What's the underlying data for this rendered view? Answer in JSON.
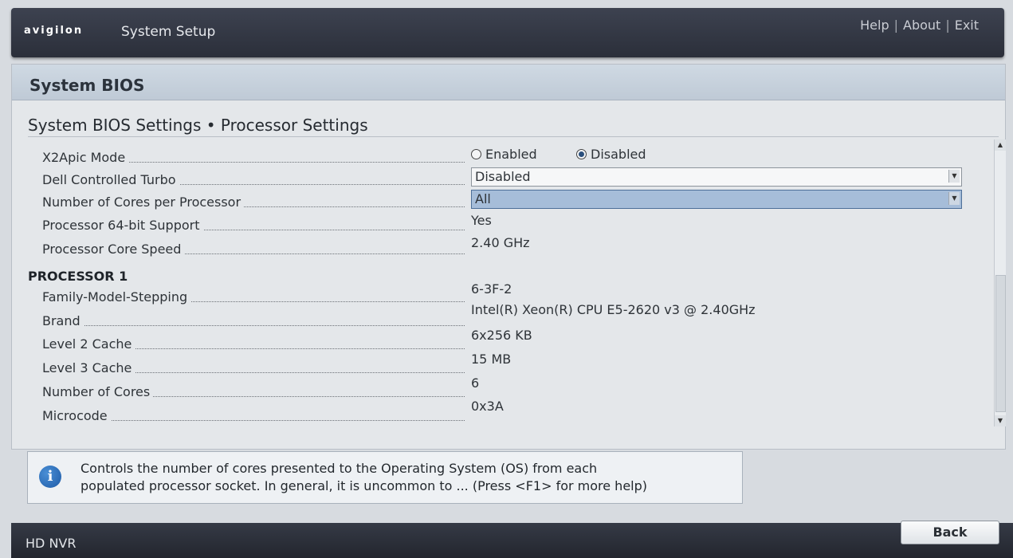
{
  "header": {
    "logo": "avigilon",
    "title": "System Setup",
    "links": [
      "Help",
      "About",
      "Exit"
    ]
  },
  "panel": {
    "title": "System BIOS",
    "section_title": "System BIOS Settings • Processor Settings"
  },
  "settings": [
    {
      "label": "X2Apic Mode",
      "type": "radio",
      "options": [
        "Enabled",
        "Disabled"
      ],
      "selected": "Disabled"
    },
    {
      "label": "Dell Controlled Turbo",
      "type": "dropdown",
      "value": "Disabled"
    },
    {
      "label": "Number of Cores per Processor",
      "type": "dropdown",
      "value": "All",
      "focused": true
    },
    {
      "label": "Processor 64-bit Support",
      "type": "text",
      "value": "Yes"
    },
    {
      "label": "Processor Core Speed",
      "type": "text",
      "value": "2.40 GHz"
    }
  ],
  "processor1": {
    "header": "PROCESSOR 1",
    "rows": [
      {
        "label": "Family-Model-Stepping",
        "value": "6-3F-2"
      },
      {
        "label": "Brand",
        "value": "Intel(R) Xeon(R) CPU E5-2620 v3 @ 2.40GHz"
      },
      {
        "label": "Level 2 Cache",
        "value": "6x256 KB"
      },
      {
        "label": "Level 3 Cache",
        "value": "15 MB"
      },
      {
        "label": "Number of Cores",
        "value": "6"
      },
      {
        "label": "Microcode",
        "value": "0x3A"
      }
    ]
  },
  "help": {
    "line1": "Controls the number of cores presented to the Operating System (OS) from each",
    "line2": "populated processor socket. In general, it is uncommon to ... (Press <F1> for more help)"
  },
  "footer": {
    "device": "HD NVR",
    "back_label": "Back"
  },
  "icons": {
    "info": "info-icon",
    "scroll_up": "scroll-up-arrow-icon",
    "scroll_down": "scroll-down-arrow-icon",
    "dropdown": "dropdown-arrow-icon"
  },
  "colors": {
    "topbar": "#2b2f3a",
    "panel_header": "#c5d0dc",
    "selected_field": "#a6bdd9",
    "info_icon": "#1d5aa6"
  }
}
